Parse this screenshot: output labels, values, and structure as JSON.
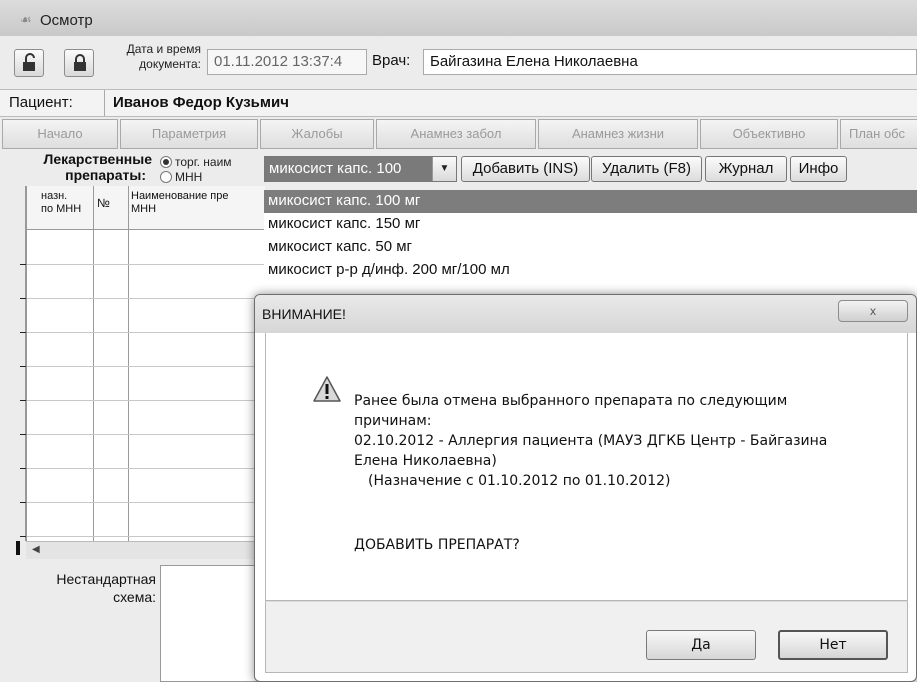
{
  "window": {
    "title": "Осмотр",
    "icon": "stethoscope-icon"
  },
  "toolbar": {
    "button1_icon": "unlock-icon",
    "button2_icon": "lock-icon",
    "date_label_line1": "Дата и время",
    "date_label_line2": "документа:",
    "date_value": "01.11.2012 13:37:4",
    "doctor_label": "Врач:",
    "doctor_value": "Байгазина Елена Николаевна"
  },
  "patient": {
    "label": "Пациент:",
    "name": "Иванов Федор Кузьмич"
  },
  "tabs": [
    {
      "label": "Начало"
    },
    {
      "label": "Параметрия"
    },
    {
      "label": "Жалобы"
    },
    {
      "label": "Анамнез забол"
    },
    {
      "label": "Анамнез жизни"
    },
    {
      "label": "Объективно"
    },
    {
      "label": "План обс"
    }
  ],
  "drugs": {
    "label_line1": "Лекарственные",
    "label_line2": "препараты:",
    "radio_options": [
      {
        "label": "торг. наим",
        "selected": true
      },
      {
        "label": "МНН",
        "selected": false
      }
    ],
    "combo_value": "микосист капс. 100",
    "buttons": {
      "add": "Добавить (INS)",
      "delete": "Удалить (F8)",
      "journal": "Журнал",
      "info": "Инфо"
    }
  },
  "grid": {
    "col1_line1": "назн.",
    "col1_line2": "по МНН",
    "col2": "№",
    "col3_line1": "Наименование пре",
    "col3_line2": "МНН"
  },
  "nonstandard": {
    "label_line1": "Нестандартная",
    "label_line2": "схема:"
  },
  "dropdown": {
    "items": [
      "микосист капс. 100 мг",
      "микосист капс. 150 мг",
      "микосист капс. 50 мг",
      "микосист р-р д/инф. 200 мг/100 мл"
    ]
  },
  "dialog": {
    "title": "ВНИМАНИЕ!",
    "close_label": "x",
    "icon": "warning-icon",
    "message_line1": "Ранее была отмена выбранного препарата по следующим",
    "message_line2": "причинам:",
    "message_line3": "02.10.2012 - Аллергия пациента (МАУЗ ДГКБ Центр - Байгазина",
    "message_line4": "Елена Николаевна)",
    "message_line5": "(Назначение с 01.10.2012 по 01.10.2012)",
    "question": "ДОБАВИТЬ ПРЕПАРАТ?",
    "yes_label": "Да",
    "no_label": "Нет"
  },
  "colors": {
    "highlight": "#7d7d7d",
    "background": "#ececec"
  }
}
